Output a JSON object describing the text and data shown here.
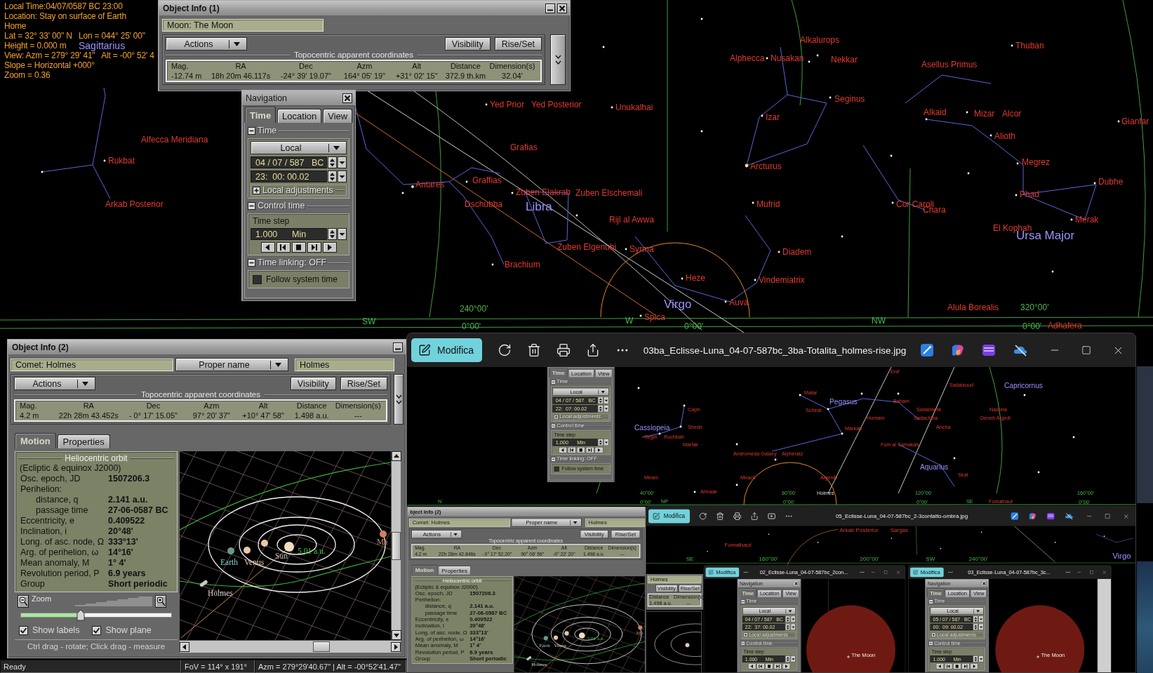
{
  "info_overlay": {
    "lines": [
      "Local Time:04/07/0587 BC 23:00",
      "Location: Stay on surface of Earth",
      "Home",
      "Lat = 32° 33' 00\" N   Lon = 044° 25' 00\"",
      "Height = 0.000 m",
      "View: Azm = 279° 29' 41\"   Alt = -00° 52' 4",
      "Slope = Horizontal +000°",
      "Zoom = 0.36"
    ]
  },
  "sky": {
    "labels": [
      {
        "text": "Sagittarius",
        "kind": "constellation"
      },
      {
        "text": "Alkalurops",
        "kind": "star"
      },
      {
        "text": "Thuban",
        "kind": "star"
      },
      {
        "text": "Alphecca",
        "kind": "star"
      },
      {
        "text": "Nusakan",
        "kind": "star"
      },
      {
        "text": "Nekkar",
        "kind": "star"
      },
      {
        "text": "Asellus Primus",
        "kind": "star"
      },
      {
        "text": "Yed Prior",
        "kind": "star"
      },
      {
        "text": "Yed Posterior",
        "kind": "star"
      },
      {
        "text": "Unukalhai",
        "kind": "star"
      },
      {
        "text": "Seginus",
        "kind": "star"
      },
      {
        "text": "Izar",
        "kind": "star"
      },
      {
        "text": "Alkaid",
        "kind": "star"
      },
      {
        "text": "Mizar",
        "kind": "star"
      },
      {
        "text": "Alcor",
        "kind": "star"
      },
      {
        "text": "Gianfar",
        "kind": "star"
      },
      {
        "text": "Alfecca Meridiana",
        "kind": "star"
      },
      {
        "text": "Alioth",
        "kind": "star"
      },
      {
        "text": "Grafias",
        "kind": "star"
      },
      {
        "text": "Rukbat",
        "kind": "star"
      },
      {
        "text": "Arcturus",
        "kind": "star"
      },
      {
        "text": "Megrez",
        "kind": "star"
      },
      {
        "text": "Antares",
        "kind": "star"
      },
      {
        "text": "Graffias",
        "kind": "star"
      },
      {
        "text": "Dubhe",
        "kind": "star"
      },
      {
        "text": "Zuben Elakrab",
        "kind": "star"
      },
      {
        "text": "Zuben Elschemali",
        "kind": "star"
      },
      {
        "text": "Phad",
        "kind": "star"
      },
      {
        "text": "Arkab Posterior",
        "kind": "star"
      },
      {
        "text": "Dschubba",
        "kind": "star"
      },
      {
        "text": "Libra",
        "kind": "constellation"
      },
      {
        "text": "Mufrid",
        "kind": "star"
      },
      {
        "text": "Cor Caroli",
        "kind": "star"
      },
      {
        "text": "Chara",
        "kind": "star"
      },
      {
        "text": "Rijl al Awwa",
        "kind": "star"
      },
      {
        "text": "El Kophah",
        "kind": "star"
      },
      {
        "text": "Merak",
        "kind": "star"
      },
      {
        "text": "Ursa Major",
        "kind": "constellation"
      },
      {
        "text": "Zuben Elgenubi",
        "kind": "star"
      },
      {
        "text": "Syrma",
        "kind": "star"
      },
      {
        "text": "Diadem",
        "kind": "star"
      },
      {
        "text": "Brachium",
        "kind": "star"
      },
      {
        "text": "Heze",
        "kind": "star"
      },
      {
        "text": "Vindemiatrix",
        "kind": "star"
      },
      {
        "text": "240°00'",
        "kind": "grid"
      },
      {
        "text": "Virgo",
        "kind": "constellation"
      },
      {
        "text": "Auva",
        "kind": "star"
      },
      {
        "text": "Alula Borealis",
        "kind": "star"
      },
      {
        "text": "320°00'",
        "kind": "grid"
      },
      {
        "text": "SW",
        "kind": "compass"
      },
      {
        "text": "0°00'",
        "kind": "grid"
      },
      {
        "text": "W",
        "kind": "compass"
      },
      {
        "text": "Spica",
        "kind": "star"
      },
      {
        "text": "0°00'",
        "kind": "grid"
      },
      {
        "text": "NW",
        "kind": "compass"
      },
      {
        "text": "0°00'",
        "kind": "grid"
      },
      {
        "text": "Adhafera",
        "kind": "star"
      }
    ]
  },
  "object_info_1": {
    "title": "Object Info (1)",
    "object": "Moon: The Moon",
    "actions": "Actions",
    "buttons": [
      "Visibility",
      "Rise/Set"
    ],
    "coordinates": {
      "title": "Topocentric apparent coordinates",
      "columns": [
        "Mag.",
        "RA",
        "Dec",
        "Azm",
        "Alt",
        "Distance",
        "Dimension(s)"
      ],
      "values": [
        "-12.74 m",
        "18h 20m 46.117s",
        "-24° 39' 19.07\"",
        "164° 05' 19\"",
        "+31° 02' 15\"",
        "372.9 th.km",
        "32.04'"
      ]
    }
  },
  "navigation": {
    "title": "Navigation",
    "tabs": [
      {
        "label": "Time",
        "selected": true
      },
      {
        "label": "Location",
        "selected": false
      },
      {
        "label": "View",
        "selected": false
      }
    ],
    "sections": [
      {
        "kind": "time",
        "title": "Time",
        "expanded": true,
        "scale": "Local",
        "date": "04 / 07 / 587   BC",
        "time": "23:  00: 00.02",
        "adjustments": {
          "title": "Local adjustments",
          "expanded": false
        }
      },
      {
        "kind": "control",
        "title": "Control time",
        "expanded": true,
        "step_label": "Time step",
        "step": "1.000      Min"
      },
      {
        "kind": "linking",
        "title": "Time linking: OFF",
        "expanded": true,
        "follow": {
          "label": "Follow system time",
          "checked": false
        }
      }
    ]
  },
  "object_info_2": {
    "title": "Object Info (2)",
    "object": "Comet: Holmes",
    "name_type": "Proper name",
    "name": "Holmes",
    "actions": "Actions",
    "buttons": [
      "Visibility",
      "Rise/Set"
    ],
    "coordinates": {
      "title": "Topocentric apparent coordinates",
      "columns": [
        "Mag.",
        "RA",
        "Dec",
        "Azm",
        "Alt",
        "Distance",
        "Dimension(s)"
      ],
      "values": [
        "4.2 m",
        "22h 28m 43.452s",
        "- 0° 17' 15.05\"",
        "97° 20' 37\"",
        "+10° 47' 58\"",
        "1.498 a.u.",
        "---"
      ]
    },
    "tabs": [
      {
        "label": "Motion",
        "selected": true
      },
      {
        "label": "Properties",
        "selected": false
      }
    ],
    "orbit": {
      "title": "Heliocentric orbit",
      "subtitle": "(Ecliptic & equinox J2000)",
      "rows": [
        {
          "label": "Osc. epoch, JD",
          "value": "1507206.3"
        },
        {
          "label": "Perihelion:",
          "children": [
            {
              "label": "distance, q",
              "value": "2.141 a.u."
            },
            {
              "label": "passage time",
              "value": "27-06-0587 BC"
            }
          ]
        },
        {
          "label": "Eccentricity, e",
          "value": "0.409522"
        },
        {
          "label": "Inclination, i",
          "value": "20°48'"
        },
        {
          "label": "Long. of asc. node, Ω",
          "value": "333°13'"
        },
        {
          "label": "Arg. of perihelion, ω",
          "value": "14°16'"
        },
        {
          "label": "Mean anomaly, M",
          "value": "1° 4'"
        },
        {
          "label": "Revolution period, P",
          "value": "6.9 years"
        },
        {
          "label": "Group",
          "value": "Short periodic"
        }
      ]
    },
    "zoom": {
      "label": "Zoom",
      "level": 0.39
    },
    "checkboxes": [
      {
        "label": "Show labels",
        "checked": true
      },
      {
        "label": "Show plane",
        "checked": true
      }
    ],
    "hint": "Ctrl drag - rotate; Click drag - measure",
    "view_labels": [
      {
        "kind": "earth",
        "text": "Earth"
      },
      {
        "kind": "venus",
        "text": "Venus"
      },
      {
        "kind": "sun",
        "text": "Sun"
      },
      {
        "kind": "distance",
        "text": "5.01 a.u."
      },
      {
        "kind": "mars",
        "text": "Ma"
      },
      {
        "kind": "comet",
        "text": "Holmes"
      }
    ]
  },
  "status_bar": [
    "Ready",
    "FoV = 114° x 191°",
    "Azm = 279°29'40.67\" | Alt = -00°52'41.47\""
  ],
  "viewer": {
    "toolbar": [
      {
        "kind": "edit",
        "label": "Modifica"
      },
      {
        "kind": "rotate"
      },
      {
        "kind": "delete"
      },
      {
        "kind": "print"
      },
      {
        "kind": "share"
      },
      {
        "kind": "more"
      }
    ],
    "filename": "03ba_Eclisse-Luna_04-07-587bc_3ba-Totalita_holmes-rise.jpg",
    "apps": [
      {
        "kind": "designer"
      },
      {
        "kind": "copilot"
      },
      {
        "kind": "clipchamp"
      },
      {
        "kind": "onedrive"
      }
    ],
    "image": {
      "sky_labels": [
        {
          "text": "Enif",
          "kind": "star"
        },
        {
          "text": "Sadalsuud",
          "kind": "star"
        },
        {
          "text": "Capricornus",
          "kind": "constellation"
        },
        {
          "text": "Matar",
          "kind": "star"
        },
        {
          "text": "Pegasus",
          "kind": "constellation"
        },
        {
          "text": "Baham",
          "kind": "star"
        },
        {
          "text": "Caph",
          "kind": "star"
        },
        {
          "text": "Scheat",
          "kind": "star"
        },
        {
          "text": "Sadalmelik",
          "kind": "star"
        },
        {
          "text": "Nashira",
          "kind": "star"
        },
        {
          "text": "Homam",
          "kind": "star"
        },
        {
          "text": "Sadachbia",
          "kind": "star"
        },
        {
          "text": "Deneb Algedi",
          "kind": "star"
        },
        {
          "text": "Cassiopeia",
          "kind": "constellation"
        },
        {
          "text": "Shedir",
          "kind": "star"
        },
        {
          "text": "Markab",
          "kind": "star"
        },
        {
          "text": "Ancha",
          "kind": "star"
        },
        {
          "text": "Segin",
          "kind": "star"
        },
        {
          "text": "Ruchbah",
          "kind": "star"
        },
        {
          "text": "Marfak",
          "kind": "star"
        },
        {
          "text": "Fum al Samakah",
          "kind": "star"
        },
        {
          "text": "Andromeda Galaxy",
          "kind": "star"
        },
        {
          "text": "Alpheratz",
          "kind": "star"
        },
        {
          "text": "Aquarius",
          "kind": "constellation"
        },
        {
          "text": "Miram",
          "kind": "star"
        },
        {
          "text": "Mirach",
          "kind": "star"
        },
        {
          "text": "Algenib",
          "kind": "star"
        },
        {
          "text": "Skat",
          "kind": "star"
        },
        {
          "text": "40°00'",
          "kind": "grid"
        },
        {
          "text": "Almaak",
          "kind": "star"
        },
        {
          "text": "80°00'",
          "kind": "grid"
        },
        {
          "text": "Holmes",
          "kind": "comet"
        },
        {
          "text": "120°00'",
          "kind": "grid"
        },
        {
          "text": "160°00'",
          "kind": "grid"
        },
        {
          "text": "N",
          "kind": "compass"
        },
        {
          "text": "0°00'",
          "kind": "grid"
        },
        {
          "text": "NP",
          "kind": "compass"
        },
        {
          "text": "0°00'",
          "kind": "grid"
        },
        {
          "text": "0°00'",
          "kind": "grid"
        },
        {
          "text": "SE",
          "kind": "compass"
        },
        {
          "text": "Fomalhaut",
          "kind": "star"
        },
        {
          "text": "0°00'",
          "kind": "grid"
        }
      ],
      "navigation": {
        "tabs": [
          {
            "label": "Time",
            "selected": true
          },
          {
            "label": "Location",
            "selected": false
          },
          {
            "label": "View",
            "selected": false
          }
        ],
        "sections": [
          {
            "kind": "time",
            "title": "Time",
            "expanded": true,
            "scale": "Local",
            "date": "04 / 07 / 587   BC",
            "time": "22:  07: 00.02",
            "adjustments": {
              "title": "Local adjustments",
              "expanded": false
            }
          },
          {
            "kind": "control",
            "title": "Control time",
            "expanded": true,
            "step_label": "Time step",
            "step": "1.000      Min"
          },
          {
            "kind": "linking",
            "title": "Time linking: OFF",
            "expanded": true,
            "follow": {
              "label": "Follow system time",
              "checked": false
            }
          }
        ]
      },
      "object_info": {
        "title": "bject Info (2)",
        "object": "Comet: Holmes",
        "name_type": "Proper name",
        "name": "Holmes",
        "actions": "Actions",
        "buttons": [
          "Visibility",
          "Rise/Set"
        ],
        "coordinates": {
          "title": "Topocentric apparent coordinates",
          "columns": [
            "Mag.",
            "RA",
            "Dec",
            "Azm",
            "Alt",
            "Distance",
            "Dimension(s)"
          ],
          "values": [
            "4.2 m",
            "22h 28m 42.846s",
            "- 0° 17' 52.20\"",
            "90° 06' 56\"",
            "-0° 22' 20\"",
            "1.498 a.u.",
            "---"
          ]
        },
        "tabs": [
          {
            "label": "Motion",
            "selected": true
          },
          {
            "label": "Properties",
            "selected": false
          }
        ],
        "orbit": {
          "title": "Heliocentric orbit",
          "subtitle": "(Ecliptic & equinox J2000)",
          "rows": [
            {
              "label": "Osc. epoch, JD",
              "value": "1507206.3"
            },
            {
              "label": "Perihelion:",
              "children": [
                {
                  "label": "distance, q",
                  "value": "2.141 a.u."
                },
                {
                  "label": "passage time",
                  "value": "27-06-0587 BC"
                }
              ]
            },
            {
              "label": "Eccentricity, e",
              "value": "0.409522"
            },
            {
              "label": "Inclination, i",
              "value": "20°48'"
            },
            {
              "label": "Long. of asc. node, Ω",
              "value": "333°13'"
            },
            {
              "label": "Arg. of perihelion, ω",
              "value": "14°16'"
            },
            {
              "label": "Mean anomaly, M",
              "value": "1° 4'"
            },
            {
              "label": "Revolution period, P",
              "value": "6.9 years"
            },
            {
              "label": "Group",
              "value": "Short periodic"
            }
          ]
        },
        "view_labels": [
          {
            "kind": "earth",
            "text": "Earth"
          },
          {
            "kind": "venus",
            "text": "Venus"
          },
          {
            "kind": "distance",
            "text": "5.01 a.u."
          },
          {
            "kind": "mars",
            "text": "Ma"
          },
          {
            "kind": "comet",
            "text": "Holmes"
          }
        ]
      },
      "viewer": {
        "toolbar": [
          {
            "kind": "edit",
            "label": "Modifica"
          },
          {
            "kind": "rotate"
          },
          {
            "kind": "delete"
          },
          {
            "kind": "print"
          },
          {
            "kind": "share"
          },
          {
            "kind": "slideshow"
          },
          {
            "kind": "more"
          }
        ],
        "filename": "05_Eclisse-Luna_04-07-587bc_2-3contatto-ombra.jpg",
        "apps": [
          {
            "kind": "designer"
          },
          {
            "kind": "copilot"
          },
          {
            "kind": "clipchamp"
          },
          {
            "kind": "onedrive"
          }
        ],
        "image": {
          "sky_labels": [
            {
              "text": "Arkab Posterior",
              "kind": "star"
            },
            {
              "text": "Sargas",
              "kind": "star"
            },
            {
              "text": "Fomalhaut",
              "kind": "star"
            },
            {
              "text": "SE",
              "kind": "compass"
            },
            {
              "text": "160°00'",
              "kind": "grid"
            },
            {
              "text": "200°00'",
              "kind": "grid"
            },
            {
              "text": "SW",
              "kind": "compass"
            },
            {
              "text": "240°00'",
              "kind": "grid"
            },
            {
              "text": "Virgo",
              "kind": "constellation"
            }
          ],
          "fragment": {
            "name": "Holmes",
            "buttons": [
              "Visibility",
              "Rise/Set"
            ],
            "columns": [
              "Distance",
              "Dimension(s)"
            ],
            "values": [
              "1.498 a.u.",
              "---"
            ]
          },
          "viewers": [
            {
              "toolbar": [
                {
                  "kind": "edit",
                  "label": "Modifica"
                },
                {
                  "kind": "more"
                }
              ],
              "filename": "02_Eclisse-Luna_04-07-587bc_2con...",
              "apps": [
                {
                  "kind": "more"
                }
              ],
              "image": {
                "navigation": {
                  "title": "Navigation",
                  "tabs": [
                    {
                      "label": "Time",
                      "selected": true
                    },
                    {
                      "label": "Location",
                      "selected": false
                    },
                    {
                      "label": "View",
                      "selected": false
                    }
                  ],
                  "sections": [
                    {
                      "kind": "time",
                      "title": "Time",
                      "expanded": true,
                      "scale": "Local",
                      "date": "04 / 07 / 587   BC",
                      "time": "22:  37: 00.02",
                      "adjustments": {
                        "title": "Local adjustments",
                        "expanded": false
                      }
                    },
                    {
                      "kind": "control",
                      "title": "Control time",
                      "expanded": true,
                      "step_label": "Time step",
                      "step": "1.000      Min"
                    }
                  ]
                },
                "moon_label": "The Moon"
              }
            },
            {
              "toolbar": [
                {
                  "kind": "edit",
                  "label": "Modifica"
                },
                {
                  "kind": "more"
                }
              ],
              "filename": "03_Eclisse-Luna_04-07-587bc_3c...",
              "apps": [
                {
                  "kind": "more"
                }
              ],
              "image": {
                "navigation": {
                  "title": "Navigation",
                  "tabs": [
                    {
                      "label": "Time",
                      "selected": true
                    },
                    {
                      "label": "Location",
                      "selected": false
                    },
                    {
                      "label": "View",
                      "selected": false
                    }
                  ],
                  "sections": [
                    {
                      "kind": "time",
                      "title": "Time",
                      "expanded": true,
                      "scale": "Local",
                      "date": "05 / 07 / 587   BC",
                      "time": "00:  09: 00.02",
                      "adjustments": {
                        "title": "Local adjustments",
                        "expanded": false
                      }
                    },
                    {
                      "kind": "control",
                      "title": "Control time",
                      "expanded": true,
                      "step_label": "Time step",
                      "step": "1.000      Min"
                    }
                  ]
                },
                "moon_label": "The Moon"
              }
            }
          ]
        }
      }
    }
  }
}
